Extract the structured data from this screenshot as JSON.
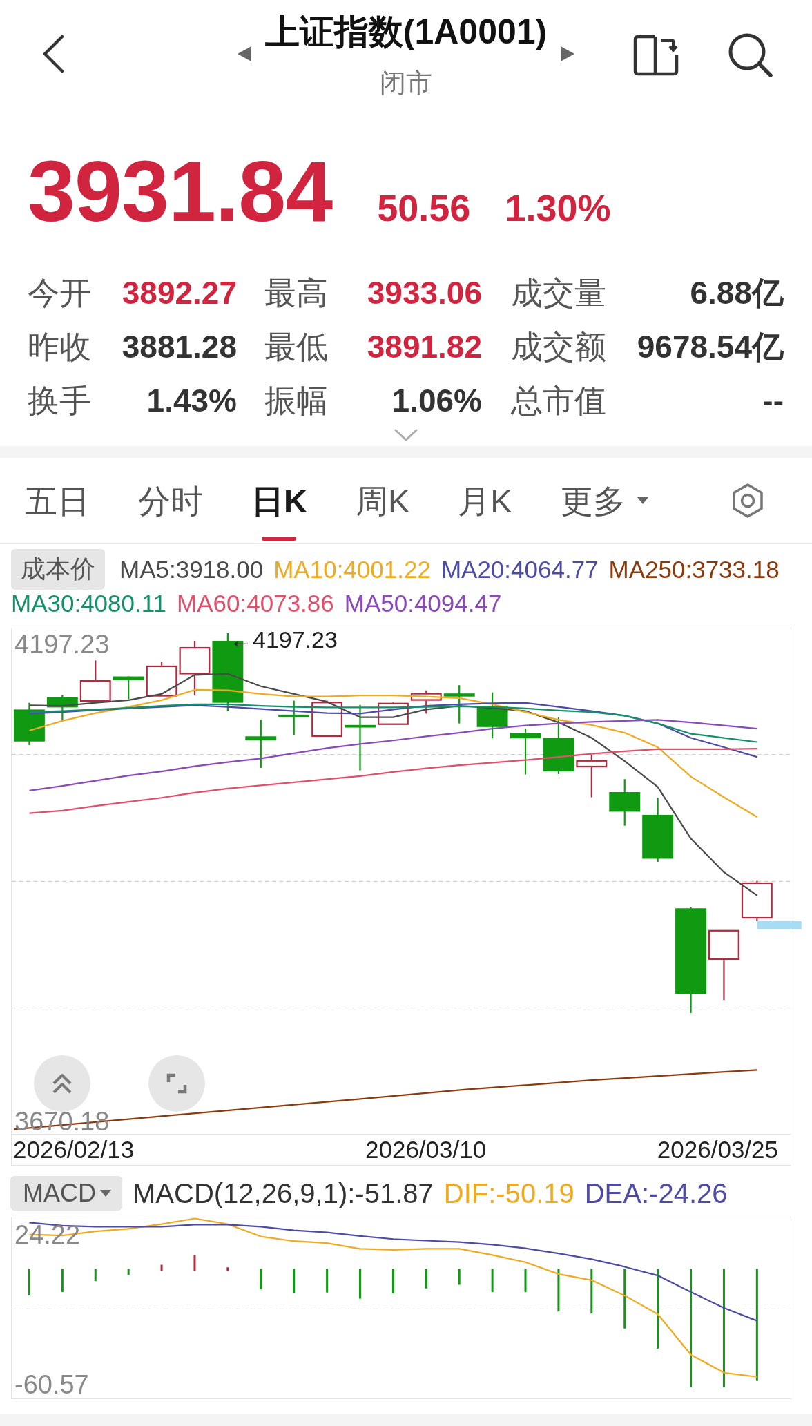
{
  "header": {
    "title": "上证指数(1A0001)",
    "status": "闭市"
  },
  "quote": {
    "price": "3931.84",
    "change": "50.56",
    "change_percent": "1.30%",
    "rising": true
  },
  "stats": [
    {
      "label": "今开",
      "value": "3892.27",
      "color": "#d0243f"
    },
    {
      "label": "最高",
      "value": "3933.06",
      "color": "#d0243f"
    },
    {
      "label": "成交量",
      "value": "6.88亿",
      "color": "#333333"
    },
    {
      "label": "昨收",
      "value": "3881.28",
      "color": "#333333"
    },
    {
      "label": "最低",
      "value": "3891.82",
      "color": "#d0243f"
    },
    {
      "label": "成交额",
      "value": "9678.54亿",
      "color": "#333333"
    },
    {
      "label": "换手",
      "value": "1.43%",
      "color": "#333333"
    },
    {
      "label": "振幅",
      "value": "1.06%",
      "color": "#333333"
    },
    {
      "label": "总市值",
      "value": "--",
      "color": "#333333"
    }
  ],
  "tabs": [
    {
      "label": "五日",
      "selected": false,
      "kind": "plain"
    },
    {
      "label": "分时",
      "selected": false,
      "kind": "plain"
    },
    {
      "label": "日K",
      "selected": true,
      "kind": "plain"
    },
    {
      "label": "周K",
      "selected": false,
      "kind": "plain"
    },
    {
      "label": "月K",
      "selected": false,
      "kind": "plain"
    },
    {
      "label": "更多",
      "selected": false,
      "kind": "dropdown"
    }
  ],
  "indicators": {
    "cost_button": "成本价",
    "moving_averages": [
      {
        "label": "MA5:3918.00",
        "color": "#4a4a4a"
      },
      {
        "label": "MA10:4001.22",
        "color": "#f0aa20"
      },
      {
        "label": "MA20:4064.77",
        "color": "#4c4ca6"
      },
      {
        "label": "MA250:3733.18",
        "color": "#8b3a0c"
      },
      {
        "label": "MA30:4080.11",
        "color": "#13906a"
      },
      {
        "label": "MA60:4073.86",
        "color": "#e0506a"
      },
      {
        "label": "MA50:4094.47",
        "color": "#8a4ab8"
      }
    ]
  },
  "kline_chart": {
    "y_max_label": "4197.23",
    "y_min_label": "3670.18",
    "peak_label": "←4197.23",
    "dates": [
      "2026/02/13",
      "2026/03/10",
      "2026/03/25"
    ]
  },
  "macd": {
    "selector": "MACD",
    "readings": [
      {
        "label": "MACD(12,26,9,1):-51.87",
        "color": "#333333"
      },
      {
        "label": "DIF:-50.19",
        "color": "#f0aa20"
      },
      {
        "label": "DEA:-24.26",
        "color": "#4c4ca6"
      }
    ],
    "y_max_label": "24.22",
    "y_min_label": "-60.57"
  }
}
